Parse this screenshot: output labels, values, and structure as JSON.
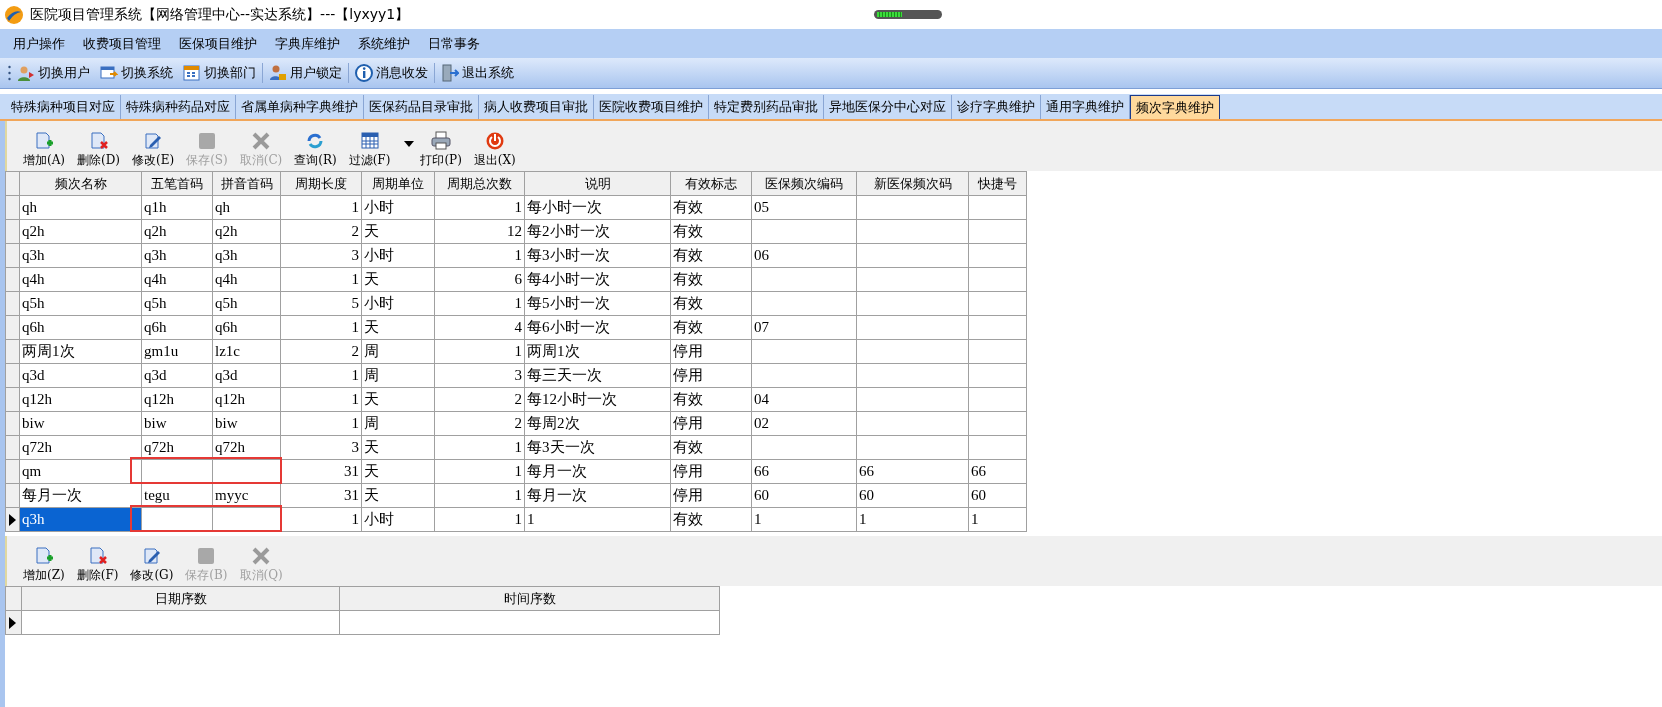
{
  "window": {
    "title": "医院项目管理系统【网络管理中心--实达系统】---【lyxyy1】"
  },
  "menu": [
    "用户操作",
    "收费项目管理",
    "医保项目维护",
    "字典库维护",
    "系统维护",
    "日常事务"
  ],
  "toolbar": [
    {
      "kind": "switch-user",
      "label": "切换用户"
    },
    {
      "kind": "switch-system",
      "label": "切换系统"
    },
    {
      "kind": "switch-department",
      "label": "切换部门"
    },
    {
      "kind": "lock",
      "label": "用户锁定"
    },
    {
      "kind": "info",
      "label": "消息收发"
    },
    {
      "kind": "exit",
      "label": "退出系统"
    }
  ],
  "tabs": [
    {
      "label": "特殊病种项目对应",
      "selected": false
    },
    {
      "label": "特殊病种药品对应",
      "selected": false
    },
    {
      "label": "省属单病种字典维护",
      "selected": false
    },
    {
      "label": "医保药品目录审批",
      "selected": false
    },
    {
      "label": "病人收费项目审批",
      "selected": false
    },
    {
      "label": "医院收费项目维护",
      "selected": false
    },
    {
      "label": "特定费别药品审批",
      "selected": false
    },
    {
      "label": "异地医保分中心对应",
      "selected": false
    },
    {
      "label": "诊疗字典维护",
      "selected": false
    },
    {
      "label": "通用字典维护",
      "selected": false
    },
    {
      "label": "频次字典维护",
      "selected": true
    }
  ],
  "actions": [
    {
      "kind": "add",
      "label": "增加(A)",
      "disabled": false
    },
    {
      "kind": "delete",
      "label": "删除(D)",
      "disabled": false
    },
    {
      "kind": "edit",
      "label": "修改(E)",
      "disabled": false
    },
    {
      "kind": "save",
      "label": "保存(S)",
      "disabled": true
    },
    {
      "kind": "cancel",
      "label": "取消(C)",
      "disabled": true
    },
    {
      "kind": "query",
      "label": "查询(R)",
      "disabled": false
    },
    {
      "kind": "filter",
      "label": "过滤(F)",
      "disabled": false
    },
    {
      "kind": "print",
      "label": "打印(P)",
      "disabled": false
    },
    {
      "kind": "exit",
      "label": "退出(X)",
      "disabled": false
    }
  ],
  "table": {
    "columns": [
      {
        "label": "频次名称"
      },
      {
        "label": "五笔首码"
      },
      {
        "label": "拼音首码"
      },
      {
        "label": "周期长度"
      },
      {
        "label": "周期单位"
      },
      {
        "label": "周期总次数"
      },
      {
        "label": "说明"
      },
      {
        "label": "有效标志"
      },
      {
        "label": "医保频次编码"
      },
      {
        "label": "新医保频次码"
      },
      {
        "label": "快捷号"
      }
    ],
    "rows": [
      {
        "name": "qh",
        "wubi": "q1h",
        "pinyin": "qh",
        "length": "1",
        "unit": "小时",
        "total": "1",
        "note": "每小时一次",
        "status": "有效",
        "code": "05",
        "selected": false,
        "marked": false
      },
      {
        "name": "q2h",
        "wubi": "q2h",
        "pinyin": "q2h",
        "length": "2",
        "unit": "天",
        "total": "12",
        "note": "每2小时一次",
        "status": "有效",
        "selected": false,
        "marked": false
      },
      {
        "name": "q3h",
        "wubi": "q3h",
        "pinyin": "q3h",
        "length": "3",
        "unit": "小时",
        "total": "1",
        "note": "每3小时一次",
        "status": "有效",
        "code": "06",
        "selected": false,
        "marked": false
      },
      {
        "name": "q4h",
        "wubi": "q4h",
        "pinyin": "q4h",
        "length": "1",
        "unit": "天",
        "total": "6",
        "note": "每4小时一次",
        "status": "有效",
        "selected": false,
        "marked": false
      },
      {
        "name": "q5h",
        "wubi": "q5h",
        "pinyin": "q5h",
        "length": "5",
        "unit": "小时",
        "total": "1",
        "note": "每5小时一次",
        "status": "有效",
        "selected": false,
        "marked": false
      },
      {
        "name": "q6h",
        "wubi": "q6h",
        "pinyin": "q6h",
        "length": "1",
        "unit": "天",
        "total": "4",
        "note": "每6小时一次",
        "status": "有效",
        "code": "07",
        "selected": false,
        "marked": false
      },
      {
        "name": "两周1次",
        "wubi": "gm1u",
        "pinyin": "lz1c",
        "length": "2",
        "unit": "周",
        "total": "1",
        "note": "两周1次",
        "status": "停用",
        "selected": false,
        "marked": false
      },
      {
        "name": "q3d",
        "wubi": "q3d",
        "pinyin": "q3d",
        "length": "1",
        "unit": "周",
        "total": "3",
        "note": "每三天一次",
        "status": "停用",
        "selected": false,
        "marked": false
      },
      {
        "name": "q12h",
        "wubi": "q12h",
        "pinyin": "q12h",
        "length": "1",
        "unit": "天",
        "total": "2",
        "note": "每12小时一次",
        "status": "有效",
        "code": "04",
        "selected": false,
        "marked": false
      },
      {
        "name": "biw",
        "wubi": "biw",
        "pinyin": "biw",
        "length": "1",
        "unit": "周",
        "total": "2",
        "note": "每周2次",
        "status": "停用",
        "code": "02",
        "selected": false,
        "marked": false
      },
      {
        "name": "q72h",
        "wubi": "q72h",
        "pinyin": "q72h",
        "length": "3",
        "unit": "天",
        "total": "1",
        "note": "每3天一次",
        "status": "有效",
        "selected": false,
        "marked": false
      },
      {
        "name": "qm",
        "length": "31",
        "unit": "天",
        "total": "1",
        "note": "每月一次",
        "status": "停用",
        "code": "66",
        "newcode": "66",
        "shortcut": "66",
        "selected": false,
        "marked": true
      },
      {
        "name": "每月一次",
        "wubi": "tegu",
        "pinyin": "myyc",
        "length": "31",
        "unit": "天",
        "total": "1",
        "note": "每月一次",
        "status": "停用",
        "code": "60",
        "newcode": "60",
        "shortcut": "60",
        "selected": false,
        "marked": false
      },
      {
        "name": "q3h",
        "length": "1",
        "unit": "小时",
        "total": "1",
        "note": "1",
        "status": "有效",
        "code": "1",
        "newcode": "1",
        "shortcut": "1",
        "selected": true,
        "marked": true
      }
    ]
  },
  "detail_actions": [
    {
      "kind": "add",
      "label": "增加(Z)",
      "disabled": false
    },
    {
      "kind": "delete",
      "label": "删除(F)",
      "disabled": false
    },
    {
      "kind": "edit",
      "label": "修改(G)",
      "disabled": false
    },
    {
      "kind": "save",
      "label": "保存(B)",
      "disabled": true
    },
    {
      "kind": "cancel",
      "label": "取消(Q)",
      "disabled": true
    }
  ],
  "detail_table": {
    "columns": [
      "日期序数",
      "时间序数"
    ],
    "rows": [
      {
        "selected": true
      }
    ]
  }
}
